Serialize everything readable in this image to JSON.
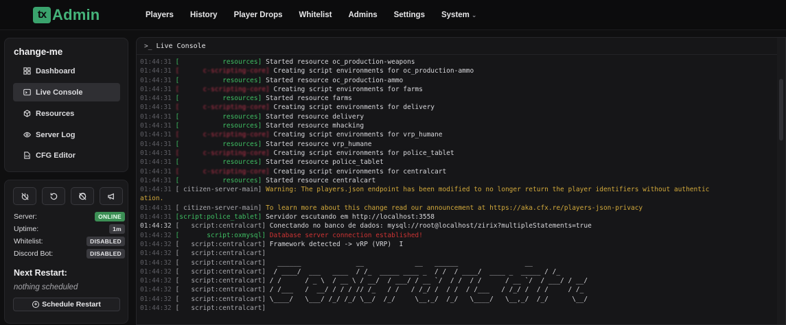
{
  "app": {
    "logo_mark": "tx",
    "logo_text": "Admin"
  },
  "nav": {
    "items": [
      "Players",
      "History",
      "Player Drops",
      "Whitelist",
      "Admins",
      "Settings",
      "System"
    ]
  },
  "sidebar": {
    "server_name": "change-me",
    "menu": [
      {
        "label": "Dashboard",
        "icon": "dashboard-icon",
        "active": false
      },
      {
        "label": "Live Console",
        "icon": "terminal-icon",
        "active": true
      },
      {
        "label": "Resources",
        "icon": "box-icon",
        "active": false
      },
      {
        "label": "Server Log",
        "icon": "eye-icon",
        "active": false
      },
      {
        "label": "CFG Editor",
        "icon": "file-code-icon",
        "active": false
      }
    ]
  },
  "status": {
    "controls": [
      "power-off-icon",
      "restart-icon",
      "stop-icon",
      "megaphone-icon"
    ],
    "rows": [
      {
        "label": "Server:",
        "value": "ONLINE"
      },
      {
        "label": "Uptime:",
        "value": "1m"
      },
      {
        "label": "Whitelist:",
        "value": "DISABLED"
      },
      {
        "label": "Discord Bot:",
        "value": "DISABLED"
      }
    ],
    "next_restart_title": "Next Restart:",
    "next_restart_value": "nothing scheduled",
    "schedule_button": "Schedule Restart"
  },
  "console": {
    "title": "Live Console",
    "prompt": ">_",
    "lines": [
      {
        "ts": "01:44:31",
        "tag": "[           resources]",
        "tagc": "green",
        "msg": "Started resource oc_production-weapons",
        "msgc": ""
      },
      {
        "ts": "01:44:31",
        "tag": "[      c-scripting-core]",
        "tagc": "red",
        "msg": "Creating script environments for oc_production-ammo",
        "msgc": ""
      },
      {
        "ts": "01:44:31",
        "tag": "[           resources]",
        "tagc": "green",
        "msg": "Started resource oc_production-ammo",
        "msgc": ""
      },
      {
        "ts": "01:44:31",
        "tag": "[      c-scripting-core]",
        "tagc": "red",
        "msg": "Creating script environments for farms",
        "msgc": ""
      },
      {
        "ts": "01:44:31",
        "tag": "[           resources]",
        "tagc": "green",
        "msg": "Started resource farms",
        "msgc": ""
      },
      {
        "ts": "01:44:31",
        "tag": "[      c-scripting-core]",
        "tagc": "red",
        "msg": "Creating script environments for delivery",
        "msgc": ""
      },
      {
        "ts": "01:44:31",
        "tag": "[           resources]",
        "tagc": "green",
        "msg": "Started resource delivery",
        "msgc": ""
      },
      {
        "ts": "01:44:31",
        "tag": "[           resources]",
        "tagc": "green",
        "msg": "Started resource mhacking",
        "msgc": ""
      },
      {
        "ts": "01:44:31",
        "tag": "[      c-scripting-core]",
        "tagc": "red",
        "msg": "Creating script environments for vrp_humane",
        "msgc": ""
      },
      {
        "ts": "01:44:31",
        "tag": "[           resources]",
        "tagc": "green",
        "msg": "Started resource vrp_humane",
        "msgc": ""
      },
      {
        "ts": "01:44:31",
        "tag": "[      c-scripting-core]",
        "tagc": "red",
        "msg": "Creating script environments for police_tablet",
        "msgc": ""
      },
      {
        "ts": "01:44:31",
        "tag": "[           resources]",
        "tagc": "green",
        "msg": "Started resource police_tablet",
        "msgc": ""
      },
      {
        "ts": "01:44:31",
        "tag": "[      c-scripting-core]",
        "tagc": "red",
        "msg": "Creating script environments for centralcart",
        "msgc": ""
      },
      {
        "ts": "01:44:31",
        "tag": "[           resources]",
        "tagc": "green",
        "msg": "Started resource centralcart",
        "msgc": ""
      },
      {
        "ts": "01:44:31",
        "tag": "[ citizen-server-main]",
        "tagc": "grey",
        "msg": "Warning: The players.json endpoint has been modified to no longer return the player identifiers without authentic",
        "msgc": "warn"
      },
      {
        "ts": "",
        "tag": "",
        "tagc": "",
        "msg": "ation.",
        "msgc": "warn"
      },
      {
        "ts": "01:44:31",
        "tag": "[ citizen-server-main]",
        "tagc": "grey",
        "msg": "To learn more about this change read our announcement at https://aka.cfx.re/players-json-privacy",
        "msgc": "warn"
      },
      {
        "ts": "01:44:31",
        "tag": "[script:police_tablet]",
        "tagc": "green",
        "msg": "Servidor escutando em http://localhost:3558",
        "msgc": ""
      },
      {
        "ts": "01:44:32",
        "tag": "[   script:centralcart]",
        "tagc": "grey",
        "msg": "Conectando no banco de dados: mysql://root@localhost/zirix?multipleStatements=true",
        "msgc": "",
        "hl": true
      },
      {
        "ts": "01:44:32",
        "tag": "[       script:oxmysql]",
        "tagc": "green",
        "msg": "Database server connection established!",
        "msgc": "err"
      },
      {
        "ts": "01:44:32",
        "tag": "[   script:centralcart]",
        "tagc": "grey",
        "msg": "Framework detected -> vRP (VRP)  I",
        "msgc": ""
      },
      {
        "ts": "01:44:32",
        "tag": "[   script:centralcart]",
        "tagc": "grey",
        "msg": "",
        "msgc": ""
      },
      {
        "ts": "01:44:32",
        "tag": "[   script:centralcart]",
        "tagc": "grey",
        "msg": "  ______              __             __   ______                 __",
        "msgc": ""
      },
      {
        "ts": "01:44:32",
        "tag": "[   script:centralcart]",
        "tagc": "grey",
        "msg": " / ____/  ___   ____  / /_  _____ ____ _  / /  / ____/  ____ _  _____ / /_",
        "msgc": ""
      },
      {
        "ts": "01:44:32",
        "tag": "[   script:centralcart]",
        "tagc": "grey",
        "msg": "/ /      / _ \\  / __ \\ / __/  / ___/ / __ `/  / /  / /      / __ `/  / ___/ / __/",
        "msgc": ""
      },
      {
        "ts": "01:44:32",
        "tag": "[   script:centralcart]",
        "tagc": "grey",
        "msg": "/ /___   /  __/ / / / // /_   / /   / /_/ /  / /  / /___   / /_/ /  / /     / /_",
        "msgc": ""
      },
      {
        "ts": "01:44:32",
        "tag": "[   script:centralcart]",
        "tagc": "grey",
        "msg": "\\____/   \\___/ /_/ /_/ \\__/  /_/     \\__,_/  /_/   \\____/   \\__,_/  /_/      \\__/",
        "msgc": ""
      },
      {
        "ts": "01:44:32",
        "tag": "[   script:centralcart]",
        "tagc": "grey",
        "msg": "",
        "msgc": ""
      }
    ]
  }
}
